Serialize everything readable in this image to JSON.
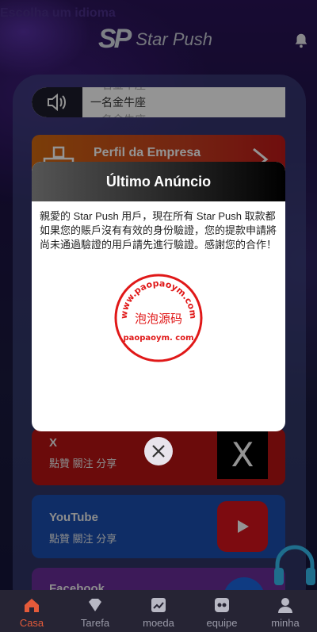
{
  "header": {
    "language_label": "Escolha um idioma",
    "logo_mark": "SP",
    "app_name": "Star Push"
  },
  "notice_bar": {
    "lines": [
      "一名金牛座",
      "一名金牛座",
      "一名金牛座"
    ]
  },
  "cards": {
    "perfil": {
      "title": "Perfil da Empresa"
    },
    "x": {
      "title": "X",
      "subtitle": "點贊 關注 分享",
      "logo": "X"
    },
    "youtube": {
      "title": "YouTube",
      "subtitle": "點贊 關注 分享"
    },
    "facebook": {
      "title": "Facebook"
    }
  },
  "modal": {
    "title": "Último Anúncio",
    "body_lines": [
      "親愛的 Star Push 用戶，現在所有 Star Push 取款都",
      "如果您的賬戶沒有有效的身份驗證，您的提款申請將",
      "尚未通過驗證的用戶請先進行驗證。感謝您的合作！"
    ],
    "stamp": {
      "top_text": "www.paopaoym.com",
      "center_text": "泡泡源码",
      "bottom_text": "paopaoym. com"
    }
  },
  "tabbar": {
    "items": [
      {
        "label": "Casa",
        "icon": "home-icon",
        "active": true
      },
      {
        "label": "Tarefa",
        "icon": "diamond-icon",
        "active": false
      },
      {
        "label": "moeda",
        "icon": "chart-icon",
        "active": false
      },
      {
        "label": "equipe",
        "icon": "team-icon",
        "active": false
      },
      {
        "label": "minha",
        "icon": "user-icon",
        "active": false
      }
    ]
  },
  "colors": {
    "active_tab": "#e45a3a",
    "stamp_red": "#e01818"
  }
}
